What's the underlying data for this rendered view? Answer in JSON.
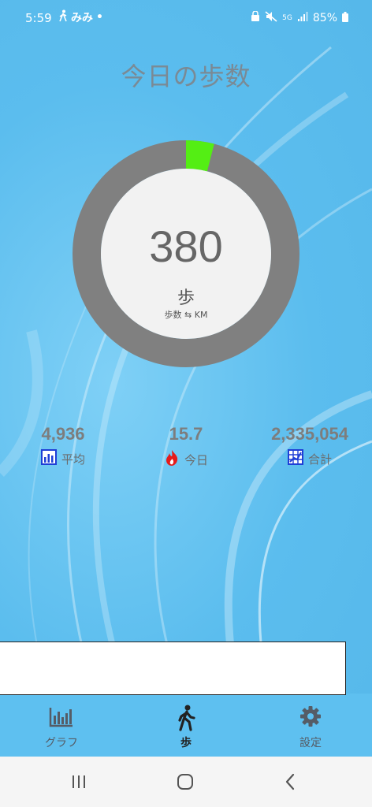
{
  "status_bar": {
    "time": "5:59",
    "app_glyphs": "みみ",
    "network": "5G",
    "battery": "85%"
  },
  "title": "今日の歩数",
  "ring": {
    "steps": "380",
    "unit": "歩",
    "toggle_label": "歩数 ⇆ KM",
    "progress_fraction": 0.04,
    "track_color": "#808080",
    "progress_color": "#54ee14"
  },
  "stats": {
    "average": {
      "value": "4,936",
      "label": "平均",
      "icon": "bar-chart-icon"
    },
    "today": {
      "value": "15.7",
      "label": "今日",
      "icon": "fire-icon"
    },
    "total": {
      "value": "2,335,054",
      "label": "合計",
      "icon": "grid-chart-icon"
    }
  },
  "bottom_nav": {
    "items": [
      {
        "label": "グラフ",
        "icon": "bar-graph-icon"
      },
      {
        "label": "歩",
        "icon": "walking-person-icon",
        "active": true
      },
      {
        "label": "設定",
        "icon": "gear-icon"
      }
    ]
  },
  "system_nav": {
    "buttons": [
      "recent-apps",
      "home",
      "back"
    ]
  }
}
